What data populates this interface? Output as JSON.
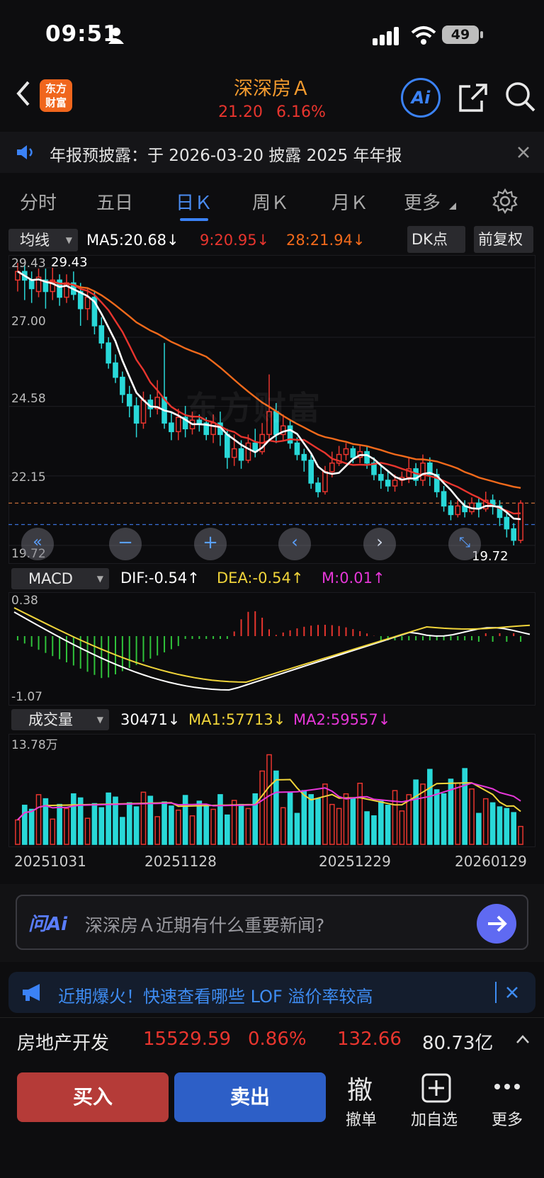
{
  "status_bar": {
    "time": "09:51",
    "battery": "49"
  },
  "header": {
    "logo_text_line1": "东方",
    "logo_text_line2": "财富",
    "stock_name": "深深房Ａ",
    "price": "21.20",
    "change_pct": "6.16%",
    "ai_label": "Ai"
  },
  "notice": {
    "text": "年报预披露：于 2026-03-20 披露 2025 年年报"
  },
  "tabs": [
    {
      "label": "分时"
    },
    {
      "label": "五日"
    },
    {
      "label": "日Ｋ"
    },
    {
      "label": "周Ｋ"
    },
    {
      "label": "月Ｋ"
    },
    {
      "label": "更多"
    }
  ],
  "active_tab": 2,
  "kline": {
    "indicator_select": "均线",
    "ma5": "MA5:20.68↓",
    "ma9": "9:20.95↓",
    "ma28": "28:21.94↓",
    "dk_button": "DK点",
    "adjust_button": "前复权",
    "y_labels": [
      "29.43",
      "27.00",
      "24.58",
      "22.15",
      "19.72"
    ],
    "high_label": "29.43",
    "low_label": "19.72",
    "watermark": "东方财富",
    "colors": {
      "up": "#e8352e",
      "down": "#29d8d8",
      "ma5": "#ffffff",
      "ma9": "#e8352e",
      "ma28": "#f26a1b"
    }
  },
  "macd": {
    "select": "MACD",
    "dif": "DIF:-0.54↑",
    "dea": "DEA:-0.54↑",
    "m": "M:0.01↑",
    "y_top": "0.38",
    "y_bottom": "-1.07"
  },
  "volume": {
    "select": "成交量",
    "vol": "30471↓",
    "ma1": "MA1:57713↓",
    "ma2": "MA2:59557↓",
    "y_top": "13.78万"
  },
  "x_dates": [
    "20251031",
    "20251128",
    "20251229",
    "20260129"
  ],
  "ask_ai": {
    "brand": "问Ai",
    "placeholder": "深深房Ａ近期有什么重要新闻?"
  },
  "promo": {
    "text": "近期爆火！快速查看哪些 LOF 溢价率较高"
  },
  "sector": {
    "name": "房地产开发",
    "index": "15529.59",
    "pct": "0.86%",
    "change": "132.66",
    "amount": "80.73亿"
  },
  "bottom_bar": {
    "buy": "买入",
    "sell": "卖出",
    "cancel_icon": "撤",
    "cancel": "撤单",
    "add_watch": "加自选",
    "more": "更多"
  },
  "chart_data": [
    {
      "type": "candlestick",
      "title": "",
      "ylim": [
        19.72,
        29.43
      ],
      "x_ticks": [
        "20251031",
        "20251128",
        "20251229",
        "20260129"
      ],
      "series": [
        {
          "name": "MA5",
          "value": 20.68
        },
        {
          "name": "9",
          "value": 20.95
        },
        {
          "name": "28",
          "value": 21.94
        }
      ],
      "candles": [
        [
          29.0,
          29.3,
          29.6,
          28.6
        ],
        [
          29.3,
          29.0,
          29.5,
          28.3
        ],
        [
          29.0,
          28.7,
          29.3,
          28.2
        ],
        [
          28.6,
          29.1,
          29.4,
          28.4
        ],
        [
          29.0,
          28.6,
          29.4,
          28.0
        ],
        [
          28.6,
          29.0,
          29.43,
          28.3
        ],
        [
          29.0,
          28.4,
          29.2,
          28.1
        ],
        [
          28.4,
          28.9,
          29.2,
          28.2
        ],
        [
          28.9,
          28.5,
          29.3,
          28.3
        ],
        [
          28.6,
          28.0,
          28.9,
          27.4
        ],
        [
          28.0,
          28.4,
          28.7,
          27.6
        ],
        [
          28.4,
          27.4,
          28.6,
          27.1
        ],
        [
          27.4,
          26.8,
          27.7,
          26.6
        ],
        [
          26.8,
          26.1,
          27.0,
          25.9
        ],
        [
          26.1,
          25.6,
          26.4,
          25.4
        ],
        [
          25.6,
          25.0,
          25.8,
          24.7
        ],
        [
          25.0,
          24.6,
          25.3,
          24.2
        ],
        [
          24.6,
          24.0,
          24.9,
          23.5
        ],
        [
          24.0,
          24.8,
          25.1,
          23.8
        ],
        [
          24.8,
          24.5,
          25.0,
          24.2
        ],
        [
          24.5,
          24.9,
          25.5,
          24.3
        ],
        [
          24.9,
          24.0,
          26.8,
          23.8
        ],
        [
          24.0,
          23.7,
          24.4,
          23.4
        ],
        [
          23.7,
          24.2,
          24.5,
          23.4
        ],
        [
          24.2,
          23.8,
          24.6,
          23.5
        ],
        [
          23.8,
          24.1,
          24.4,
          23.6
        ],
        [
          24.1,
          24.0,
          24.3,
          23.7
        ],
        [
          24.0,
          23.6,
          24.2,
          23.4
        ],
        [
          23.6,
          24.0,
          24.3,
          23.3
        ],
        [
          24.0,
          23.6,
          24.4,
          23.2
        ],
        [
          23.6,
          22.8,
          23.8,
          22.4
        ],
        [
          22.8,
          23.1,
          23.6,
          22.5
        ],
        [
          23.1,
          22.7,
          23.4,
          22.4
        ],
        [
          22.7,
          23.3,
          23.6,
          22.6
        ],
        [
          23.3,
          23.0,
          23.8,
          22.8
        ],
        [
          23.0,
          23.6,
          24.0,
          22.9
        ],
        [
          23.6,
          24.4,
          25.7,
          23.4
        ],
        [
          24.4,
          23.6,
          24.7,
          23.3
        ],
        [
          23.6,
          23.9,
          24.3,
          23.4
        ],
        [
          23.9,
          23.3,
          24.1,
          23.1
        ],
        [
          23.3,
          22.9,
          23.5,
          22.7
        ],
        [
          22.9,
          22.7,
          23.1,
          22.3
        ],
        [
          22.7,
          21.9,
          22.9,
          21.7
        ],
        [
          21.9,
          21.6,
          22.1,
          21.4
        ],
        [
          21.6,
          22.3,
          22.5,
          21.5
        ],
        [
          22.3,
          22.6,
          23.0,
          22.1
        ],
        [
          22.6,
          22.9,
          23.2,
          22.5
        ],
        [
          22.9,
          23.1,
          23.3,
          22.7
        ],
        [
          23.1,
          22.8,
          23.2,
          22.6
        ],
        [
          22.8,
          23.0,
          23.2,
          22.6
        ],
        [
          23.0,
          22.6,
          23.2,
          22.4
        ],
        [
          22.6,
          22.2,
          22.8,
          22.0
        ],
        [
          22.2,
          22.0,
          22.5,
          21.7
        ],
        [
          22.0,
          21.8,
          22.3,
          21.6
        ],
        [
          21.8,
          22.0,
          22.2,
          21.6
        ],
        [
          22.0,
          22.1,
          22.3,
          21.8
        ],
        [
          22.1,
          22.4,
          22.8,
          21.9
        ],
        [
          22.4,
          22.0,
          22.6,
          21.8
        ],
        [
          22.0,
          22.6,
          22.9,
          21.8
        ],
        [
          22.6,
          22.2,
          22.8,
          21.8
        ],
        [
          22.2,
          21.6,
          22.4,
          21.4
        ],
        [
          21.6,
          21.1,
          21.8,
          20.9
        ],
        [
          21.1,
          20.8,
          21.3,
          20.6
        ],
        [
          20.8,
          21.1,
          21.3,
          20.7
        ],
        [
          21.1,
          20.9,
          21.3,
          20.7
        ],
        [
          20.9,
          21.2,
          21.4,
          20.8
        ],
        [
          21.2,
          21.0,
          21.4,
          20.7
        ],
        [
          21.0,
          21.3,
          21.6,
          20.9
        ],
        [
          21.3,
          21.1,
          21.5,
          20.8
        ],
        [
          21.1,
          20.7,
          21.3,
          20.4
        ],
        [
          20.7,
          20.3,
          20.9,
          20.0
        ],
        [
          20.3,
          19.9,
          20.5,
          19.72
        ],
        [
          19.9,
          21.2,
          21.3,
          19.8
        ]
      ]
    },
    {
      "type": "bar",
      "name": "MACD",
      "ylim": [
        -1.07,
        0.38
      ],
      "dif_last": -0.54,
      "dea_last": -0.54,
      "m_last": 0.01
    },
    {
      "type": "bar",
      "name": "成交量",
      "ylim": [
        0,
        137800
      ],
      "vol_last": 30471,
      "ma1_last": 57713,
      "ma2_last": 59557
    }
  ]
}
